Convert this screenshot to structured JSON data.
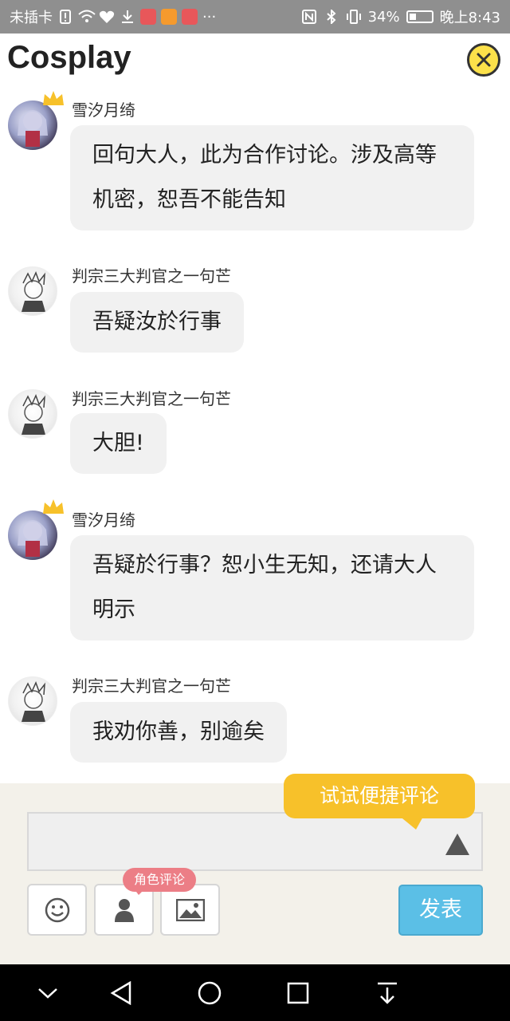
{
  "status_bar": {
    "carrier": "未插卡",
    "battery_percent": "34%",
    "battery_level": 0.34,
    "time": "晚上8:43",
    "more": "···",
    "icons": [
      "sim-alert-icon",
      "wifi-icon",
      "heart-rate-icon",
      "download-icon",
      "book-app-icon",
      "play-app-icon",
      "shop-app-icon",
      "nfc-icon",
      "bluetooth-icon",
      "vibrate-icon",
      "battery-icon"
    ]
  },
  "header": {
    "title": "Cosplay",
    "close_icon": "close-icon"
  },
  "messages": [
    {
      "author": "雪汐月绮",
      "text": "回句大人，此为合作讨论。涉及高等机密，恕吾不能告知",
      "is_admin": true
    },
    {
      "author": "判宗三大判官之一句芒",
      "text": "吾疑汝於行事",
      "is_admin": false
    },
    {
      "author": "判宗三大判官之一句芒",
      "text": "大胆!",
      "is_admin": false
    },
    {
      "author": "雪汐月绮",
      "text": "吾疑於行事？恕小生无知，还请大人明示",
      "is_admin": true
    },
    {
      "author": "判宗三大判官之一句芒",
      "text": "我劝你善，别逾矣",
      "is_admin": false
    }
  ],
  "composer": {
    "input_value": "",
    "tip": "试试便捷评论",
    "role_tag": "角色评论",
    "post_label": "发表",
    "tools": [
      "emoji-icon",
      "person-icon",
      "image-icon"
    ],
    "expand_icon": "triangle-up-icon"
  },
  "nav_bar": {
    "buttons": [
      "chevron-down-icon",
      "back-icon",
      "home-icon",
      "recents-icon",
      "pull-down-icon"
    ]
  },
  "colors": {
    "accent_yellow": "#f7c12a",
    "post_blue": "#5bbfe6",
    "role_pink": "#ec7e86",
    "bubble_gray": "#f1f1f1",
    "composer_bg": "#f3f1ea"
  }
}
